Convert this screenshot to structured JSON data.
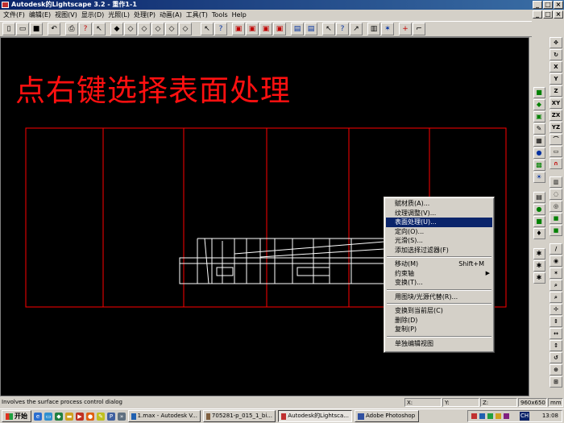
{
  "window": {
    "title": "Autodesk的Lightscape 3.2 - 重作1-1",
    "buttons": [
      "_",
      "□",
      "×"
    ]
  },
  "menubar": {
    "items": [
      "文件(F)",
      "编辑(E)",
      "视图(V)",
      "显示(D)",
      "光照(L)",
      "处理(P)",
      "动画(A)",
      "工具(T)",
      "Tools",
      "Help"
    ],
    "mdi_buttons": [
      "_",
      "□",
      "×"
    ]
  },
  "viewport": {
    "annotation": "点右键选择表面处理",
    "annotation_color": "#ff1010",
    "line_color": "#ff0000",
    "model_color": "#ffffff"
  },
  "right_toolbar": {
    "axis_labels": [
      "X",
      "Y",
      "Z",
      "XY",
      "ZX",
      "YZ"
    ]
  },
  "context_menu": {
    "groups": [
      [
        {
          "label": "赋材质(A)..."
        },
        {
          "label": "纹理调整(V)..."
        },
        {
          "label": "表面处理(U)...",
          "selected": true
        },
        {
          "label": "定向(O)..."
        },
        {
          "label": "光滑(S)..."
        },
        {
          "label": "添加选择过滤器(F)"
        }
      ],
      [
        {
          "label": "移动(M)",
          "shortcut": "Shift+M"
        },
        {
          "label": "约束轴",
          "submenu": true
        },
        {
          "label": "变换(T)..."
        }
      ],
      [
        {
          "label": "用图块/光源代替(R)..."
        }
      ],
      [
        {
          "label": "变换到当前层(C)"
        },
        {
          "label": "删除(D)"
        },
        {
          "label": "复制(P)"
        }
      ],
      [
        {
          "label": "单独编辑视图"
        }
      ]
    ]
  },
  "statusbar": {
    "message": "Involves the surface process control dialog",
    "x_label": "X:",
    "y_label": "Y:",
    "z_label": "Z:",
    "resolution": "960x650",
    "unit": "mm"
  },
  "taskbar": {
    "start_label": "开始",
    "tasks": [
      {
        "label": "1.max - Autodesk V...",
        "active": false
      },
      {
        "label": "705281-p_015_1_bi...",
        "active": false
      },
      {
        "label": "Autodesk的Lightsca...",
        "active": true
      },
      {
        "label": "Adobe Photoshop",
        "active": false
      }
    ],
    "tray_lang": "CH",
    "clock": "13:08"
  }
}
